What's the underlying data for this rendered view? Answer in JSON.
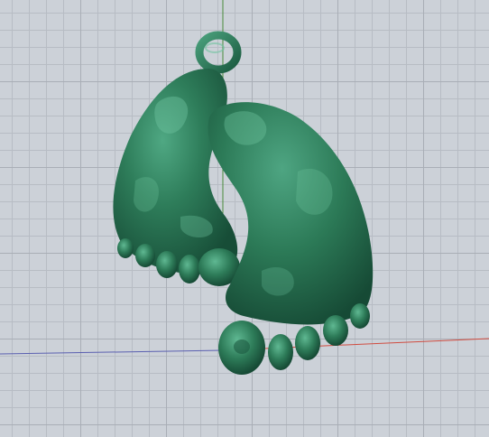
{
  "viewport": {
    "view_type": "3D perspective",
    "grid": true,
    "axes": {
      "x_axis_color": "#d04a3e",
      "y_axis_color": "#4a8a3c",
      "x_axis_negative_color": "#5a5fb0"
    },
    "background_color": "#ccd1d8"
  },
  "model": {
    "object": "baby-feet-pendant",
    "parts": [
      "loop-ring",
      "left-foot",
      "right-foot"
    ],
    "material_color": "#2e7d5a",
    "highlight_color": "#6fc3a0",
    "shadow_color": "#17503a"
  }
}
